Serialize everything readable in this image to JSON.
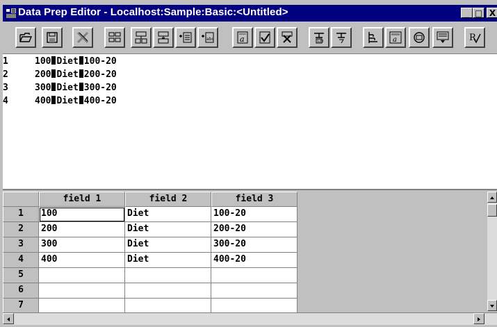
{
  "window": {
    "title": "Data Prep Editor - Localhost:Sample:Basic:<Untitled>",
    "minimize_label": "_",
    "maximize_label": "□",
    "close_label": "X"
  },
  "toolbar": {
    "buttons": [
      {
        "icon": "open-file-icon"
      },
      {
        "icon": "save-icon"
      },
      {
        "icon": "clear-icon"
      },
      {
        "icon": "split-field-icon"
      },
      {
        "icon": "join-fields-icon"
      },
      {
        "icon": "move-field-icon"
      },
      {
        "icon": "create-field-join-icon"
      },
      {
        "icon": "create-field-text-icon"
      },
      {
        "icon": "field-properties-icon"
      },
      {
        "icon": "ignore-field-icon"
      },
      {
        "icon": "cancel-icon"
      },
      {
        "icon": "select-record-icon"
      },
      {
        "icon": "reject-record-icon"
      },
      {
        "icon": "dimension-build-icon"
      },
      {
        "icon": "data-file-properties-icon"
      },
      {
        "icon": "view-icon"
      },
      {
        "icon": "associate-outline-icon"
      },
      {
        "icon": "validate-icon"
      }
    ]
  },
  "text_pane": {
    "lines": [
      {
        "num": "1",
        "parts": [
          "100",
          "Diet",
          "100-20"
        ]
      },
      {
        "num": "2",
        "parts": [
          "200",
          "Diet",
          "200-20"
        ]
      },
      {
        "num": "3",
        "parts": [
          "300",
          "Diet",
          "300-20"
        ]
      },
      {
        "num": "4",
        "parts": [
          "400",
          "Diet",
          "400-20"
        ]
      }
    ]
  },
  "grid": {
    "columns": [
      "field 1",
      "field 2",
      "field 3"
    ],
    "rows": [
      {
        "num": "1",
        "cells": [
          "100",
          "Diet",
          "100-20"
        ]
      },
      {
        "num": "2",
        "cells": [
          "200",
          "Diet",
          "200-20"
        ]
      },
      {
        "num": "3",
        "cells": [
          "300",
          "Diet",
          "300-20"
        ]
      },
      {
        "num": "4",
        "cells": [
          "400",
          "Diet",
          "400-20"
        ]
      },
      {
        "num": "5",
        "cells": [
          "",
          "",
          ""
        ]
      },
      {
        "num": "6",
        "cells": [
          "",
          "",
          ""
        ]
      },
      {
        "num": "7",
        "cells": [
          "",
          "",
          ""
        ]
      }
    ]
  }
}
